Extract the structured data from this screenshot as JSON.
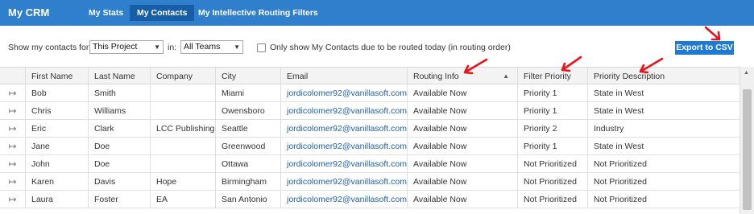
{
  "header": {
    "app_title": "My CRM",
    "tabs": [
      {
        "label": "My Stats"
      },
      {
        "label": "My Contacts"
      },
      {
        "label": "My Intellective Routing Filters"
      }
    ]
  },
  "filters": {
    "show_label": "Show my contacts for:",
    "project_value": "This Project",
    "in_label": "in:",
    "team_value": "All Teams",
    "routing_checkbox_label": "Only show My Contacts due to be routed today (in routing order)",
    "export_label": "Export to CSV"
  },
  "table": {
    "columns": [
      "First Name",
      "Last Name",
      "Company",
      "City",
      "Email",
      "Routing Info",
      "Filter Priority",
      "Priority Description"
    ],
    "rows": [
      {
        "first": "Bob",
        "last": "Smith",
        "company": "",
        "city": "Miami",
        "email": "jordicolomer92@vanillasoft.com",
        "routing": "Available Now",
        "priority": "Priority 1",
        "description": "State in West"
      },
      {
        "first": "Chris",
        "last": "Williams",
        "company": "",
        "city": "Owensboro",
        "email": "jordicolomer92@vanillasoft.com",
        "routing": "Available Now",
        "priority": "Priority 1",
        "description": "State in West"
      },
      {
        "first": "Eric",
        "last": "Clark",
        "company": "LCC Publishing",
        "city": "Seattle",
        "email": "jordicolomer92@vanillasoft.com",
        "routing": "Available Now",
        "priority": "Priority 2",
        "description": "Industry"
      },
      {
        "first": "Jane",
        "last": "Doe",
        "company": "",
        "city": "Greenwood",
        "email": "jordicolomer92@vanillasoft.com",
        "routing": "Available Now",
        "priority": "Priority 1",
        "description": "State in West"
      },
      {
        "first": "John",
        "last": "Doe",
        "company": "",
        "city": "Ottawa",
        "email": "jordicolomer92@vanillasoft.com",
        "routing": "Available Now",
        "priority": "Not Prioritized",
        "description": "Not Prioritized"
      },
      {
        "first": "Karen",
        "last": "Davis",
        "company": "Hope",
        "city": "Birmingham",
        "email": "jordicolomer92@vanillasoft.com",
        "routing": "Available Now",
        "priority": "Not Prioritized",
        "description": "Not Prioritized"
      },
      {
        "first": "Laura",
        "last": "Foster",
        "company": "EA",
        "city": "San Antonio",
        "email": "jordicolomer92@vanillasoft.com",
        "routing": "Available Now",
        "priority": "Not Prioritized",
        "description": "Not Prioritized"
      }
    ]
  },
  "icons": {
    "row_action": "open-contact-icon",
    "sort": "sort-up-icon",
    "dropdown": "chevron-down-icon",
    "annotation": "red-arrow-icon"
  },
  "colors": {
    "topbar": "#2f7fcd",
    "active_tab": "#175ea6",
    "export_button": "#1f7bd1",
    "link": "#1d5fa8",
    "annotation": "#e8141c"
  }
}
